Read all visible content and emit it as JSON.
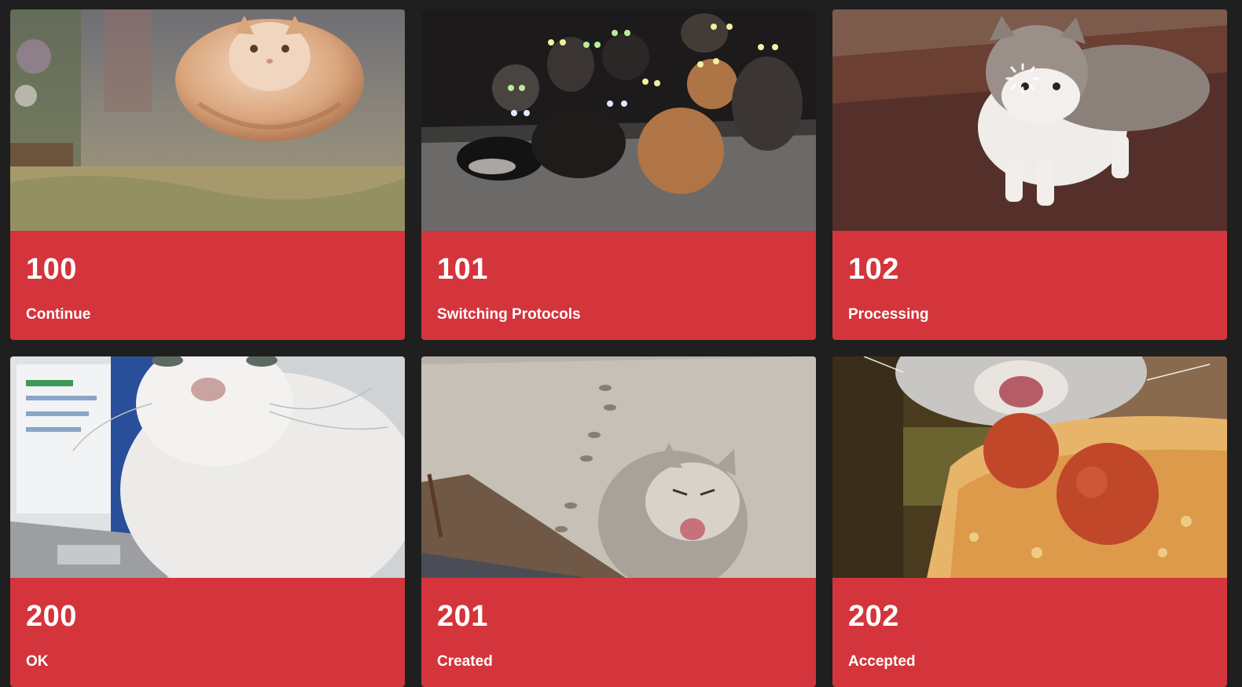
{
  "cards": [
    {
      "code": "100",
      "phrase": "Continue"
    },
    {
      "code": "101",
      "phrase": "Switching Protocols"
    },
    {
      "code": "102",
      "phrase": "Processing"
    },
    {
      "code": "200",
      "phrase": "OK"
    },
    {
      "code": "201",
      "phrase": "Created"
    },
    {
      "code": "202",
      "phrase": "Accepted"
    }
  ],
  "colors": {
    "page_background": "#1f1f1f",
    "caption_background": "#d4343c",
    "caption_text": "#ffffff"
  }
}
